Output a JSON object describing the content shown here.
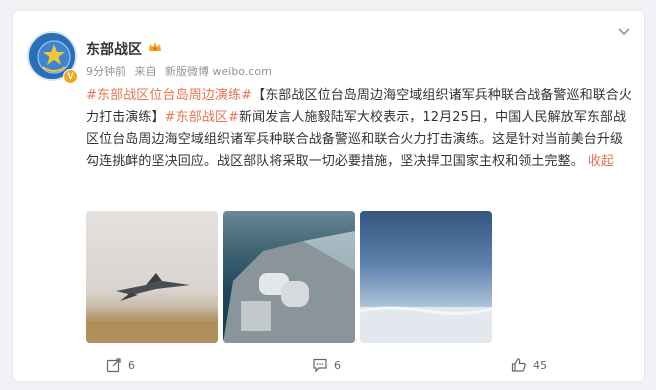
{
  "post": {
    "username": "东部战区",
    "time": "9分钟前",
    "source_prefix": "来自",
    "source": "新版微博 weibo.com",
    "tag1": "#东部战区位台岛周边演练#",
    "text1": "【东部战区位台岛周边海空域组织诸军兵种联合战备警巡和联合火力打击演练】",
    "tag2": "#东部战区#",
    "text2": "新闻发言人施毅陆军大校表示，12月25日，中国人民解放军东部战区位台岛周边海空域组织诸军兵种联合战备警巡和联合火力打击演练。这是针对当前美台升级勾连挑衅的坚决回应。战区部队将采取一切必要措施，坚决捍卫国家主权和领土完整。",
    "collapse": "收起",
    "vbadge": "V",
    "avatar_text": "东部战区"
  },
  "actions": {
    "share_count": "6",
    "comment_count": "6",
    "like_count": "45"
  },
  "colors": {
    "link": "#eb7350",
    "text": "#333333",
    "meta": "#939393"
  }
}
